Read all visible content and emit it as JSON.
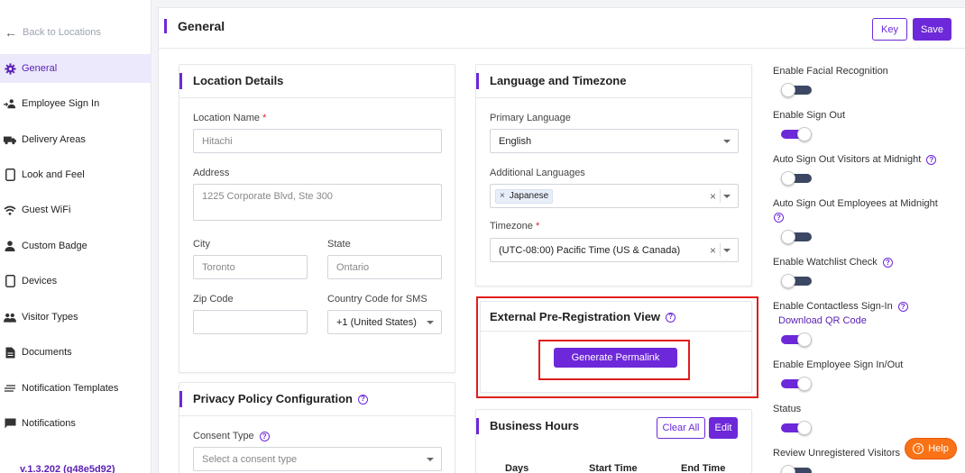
{
  "sidebar": {
    "back_label": "Back to Locations",
    "items": [
      {
        "label": "General",
        "icon": "gear-icon",
        "active": true
      },
      {
        "label": "Employee Sign In",
        "icon": "employee-icon"
      },
      {
        "label": "Delivery Areas",
        "icon": "truck-icon"
      },
      {
        "label": "Look and Feel",
        "icon": "tablet-icon"
      },
      {
        "label": "Guest WiFi",
        "icon": "wifi-icon"
      },
      {
        "label": "Custom Badge",
        "icon": "person-icon"
      },
      {
        "label": "Devices",
        "icon": "device-icon"
      },
      {
        "label": "Visitor Types",
        "icon": "people-icon"
      },
      {
        "label": "Documents",
        "icon": "document-icon"
      },
      {
        "label": "Notification Templates",
        "icon": "lines-icon"
      },
      {
        "label": "Notifications",
        "icon": "chat-icon"
      }
    ],
    "version": "v.1.3.202 (g48e5d92)"
  },
  "header": {
    "title": "General",
    "key_label": "Key",
    "save_label": "Save"
  },
  "location_details": {
    "title": "Location Details",
    "name_label": "Location Name",
    "name_required": "*",
    "name_value": "Hitachi",
    "address_label": "Address",
    "address_value": "1225 Corporate Blvd, Ste 300",
    "city_label": "City",
    "city_value": "Toronto",
    "state_label": "State",
    "state_value": "Ontario",
    "zip_label": "Zip Code",
    "zip_value": "",
    "country_label": "Country Code for SMS",
    "country_value": "+1 (United States)"
  },
  "privacy": {
    "title": "Privacy Policy Configuration",
    "consent_label": "Consent Type",
    "consent_placeholder": "Select a consent type"
  },
  "language": {
    "title": "Language and Timezone",
    "primary_label": "Primary Language",
    "primary_value": "English",
    "additional_label": "Additional Languages",
    "additional_tag": "Japanese",
    "timezone_label": "Timezone",
    "timezone_required": "*",
    "timezone_value": "(UTC-08:00) Pacific Time (US & Canada)"
  },
  "prereg": {
    "title": "External Pre-Registration View",
    "button_label": "Generate Permalink"
  },
  "business_hours": {
    "title": "Business Hours",
    "clear_label": "Clear All",
    "edit_label": "Edit",
    "columns": [
      "Days",
      "Start Time",
      "End Time"
    ]
  },
  "toggles": [
    {
      "label": "Enable Facial Recognition",
      "on": false
    },
    {
      "label": "Enable Sign Out",
      "on": true
    },
    {
      "label": "Auto Sign Out Visitors at Midnight",
      "on": false,
      "help": true
    },
    {
      "label": "Auto Sign Out Employees at Midnight",
      "on": false,
      "help": true
    },
    {
      "label": "Enable Watchlist Check",
      "on": false,
      "help": true
    },
    {
      "label": "Enable Contactless Sign-In",
      "on": true,
      "help": true,
      "link": "Download QR Code"
    },
    {
      "label": "Enable Employee Sign In/Out",
      "on": true
    },
    {
      "label": "Status",
      "on": true
    },
    {
      "label": "Review Unregistered Visitors",
      "on": false
    }
  ],
  "help_button": "Help",
  "colors": {
    "accent": "#6d28d9",
    "highlight": "#e11d1d",
    "help": "#f97316"
  }
}
